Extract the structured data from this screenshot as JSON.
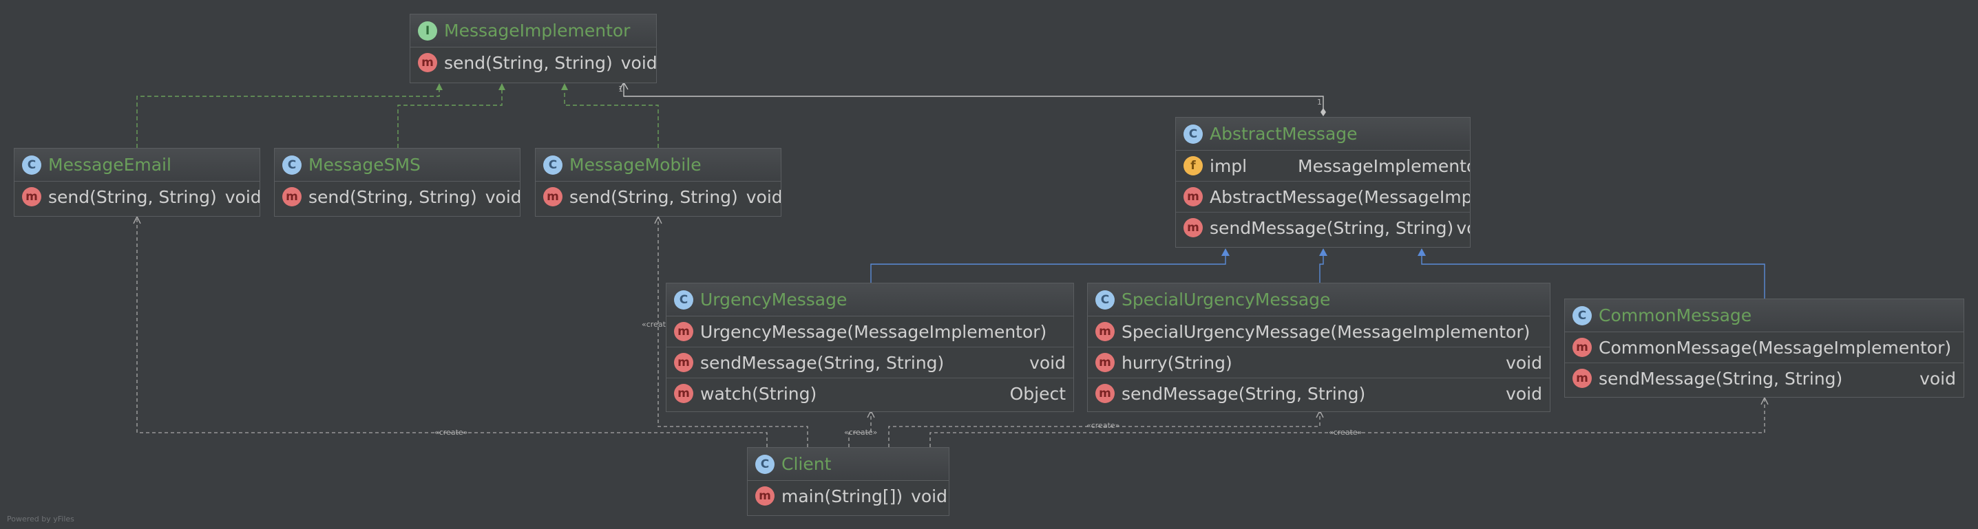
{
  "nodes": {
    "implementor": {
      "title": "MessageImplementor",
      "kind": "I",
      "members": [
        {
          "kind": "m",
          "name": "send(String, String)",
          "type": "void"
        }
      ]
    },
    "email": {
      "title": "MessageEmail",
      "kind": "C",
      "members": [
        {
          "kind": "m",
          "name": "send(String, String)",
          "type": "void"
        }
      ]
    },
    "sms": {
      "title": "MessageSMS",
      "kind": "C",
      "members": [
        {
          "kind": "m",
          "name": "send(String, String)",
          "type": "void"
        }
      ]
    },
    "mobile": {
      "title": "MessageMobile",
      "kind": "C",
      "members": [
        {
          "kind": "m",
          "name": "send(String, String)",
          "type": "void"
        }
      ]
    },
    "abstract": {
      "title": "AbstractMessage",
      "kind": "C",
      "members": [
        {
          "kind": "f",
          "name": "impl",
          "type": "MessageImplementor"
        },
        {
          "kind": "m",
          "name": "AbstractMessage(MessageImplementor)",
          "type": ""
        },
        {
          "kind": "m",
          "name": "sendMessage(String, String)",
          "type": "void"
        }
      ]
    },
    "urgency": {
      "title": "UrgencyMessage",
      "kind": "C",
      "members": [
        {
          "kind": "m",
          "name": "UrgencyMessage(MessageImplementor)",
          "type": ""
        },
        {
          "kind": "m",
          "name": "sendMessage(String, String)",
          "type": "void"
        },
        {
          "kind": "m",
          "name": "watch(String)",
          "type": "Object"
        }
      ]
    },
    "special": {
      "title": "SpecialUrgencyMessage",
      "kind": "C",
      "members": [
        {
          "kind": "m",
          "name": "SpecialUrgencyMessage(MessageImplementor)",
          "type": ""
        },
        {
          "kind": "m",
          "name": "hurry(String)",
          "type": "void"
        },
        {
          "kind": "m",
          "name": "sendMessage(String, String)",
          "type": "void"
        }
      ]
    },
    "common": {
      "title": "CommonMessage",
      "kind": "C",
      "members": [
        {
          "kind": "m",
          "name": "CommonMessage(MessageImplementor)",
          "type": ""
        },
        {
          "kind": "m",
          "name": "sendMessage(String, String)",
          "type": "void"
        }
      ]
    },
    "client": {
      "title": "Client",
      "kind": "C",
      "members": [
        {
          "kind": "m",
          "name": "main(String[])",
          "type": "void"
        }
      ]
    }
  },
  "edge_labels": {
    "create": "«create»",
    "multiplicity_top": "1",
    "multiplicity_bottom": "1"
  },
  "footer": "Powered by yFiles",
  "colors": {
    "background": "#3b3e41",
    "class_title": "#6a9f5b",
    "realization_edge": "#6a9f5b",
    "inheritance_edge": "#5b8bd8",
    "dependency_edge": "#a9a9a9",
    "composition_edge": "#c4c4c4"
  }
}
